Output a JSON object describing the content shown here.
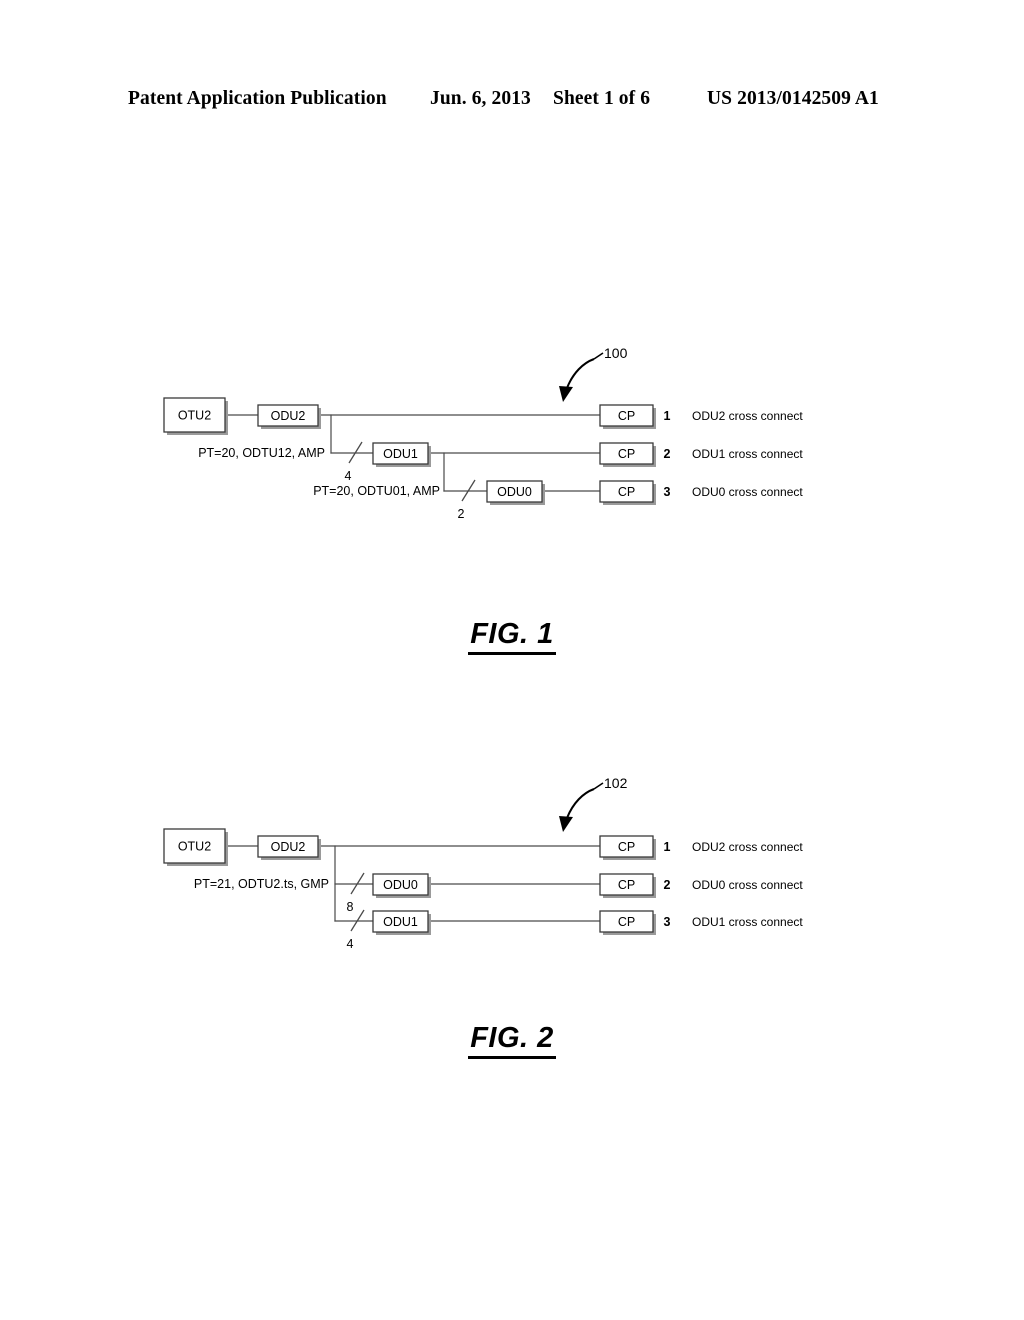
{
  "header": {
    "publication": "Patent Application Publication",
    "date": "Jun. 6, 2013",
    "sheet": "Sheet 1 of 6",
    "patent_number": "US 2013/0142509 A1"
  },
  "figures": [
    {
      "id": "figure-1",
      "caption": "FIG. 1",
      "reference_numeral": "100",
      "source_box": "OTU2",
      "nodes": [
        {
          "label": "ODU2",
          "row": 1
        },
        {
          "label": "ODU1",
          "row": 2
        },
        {
          "label": "ODU0",
          "row": 3
        }
      ],
      "mapping_labels": [
        {
          "text": "PT=20, ODTU12, AMP",
          "row": 2
        },
        {
          "text": "PT=20, ODTU01, AMP",
          "row": 3
        }
      ],
      "slash_counts": [
        {
          "value": "4",
          "row": 2
        },
        {
          "value": "2",
          "row": 3
        }
      ],
      "endpoints": [
        {
          "box": "CP",
          "index": "1",
          "description": "ODU2 cross connect"
        },
        {
          "box": "CP",
          "index": "2",
          "description": "ODU1 cross connect"
        },
        {
          "box": "CP",
          "index": "3",
          "description": "ODU0 cross connect"
        }
      ]
    },
    {
      "id": "figure-2",
      "caption": "FIG. 2",
      "reference_numeral": "102",
      "source_box": "OTU2",
      "nodes": [
        {
          "label": "ODU2",
          "row": 1
        },
        {
          "label": "ODU0",
          "row": 2
        },
        {
          "label": "ODU1",
          "row": 3
        }
      ],
      "mapping_labels": [
        {
          "text": "PT=21, ODTU2.ts, GMP",
          "row": 2
        }
      ],
      "slash_counts": [
        {
          "value": "8",
          "row": 2
        },
        {
          "value": "4",
          "row": 3
        }
      ],
      "endpoints": [
        {
          "box": "CP",
          "index": "1",
          "description": "ODU2 cross connect"
        },
        {
          "box": "CP",
          "index": "2",
          "description": "ODU0 cross connect"
        },
        {
          "box": "CP",
          "index": "3",
          "description": "ODU1 cross connect"
        }
      ]
    }
  ],
  "colors": {
    "ink": "#000000",
    "line": "#4a4a4a",
    "box_stroke": "#3a3a3a",
    "box_shadow": "#9a9a9a",
    "page": "#ffffff"
  }
}
